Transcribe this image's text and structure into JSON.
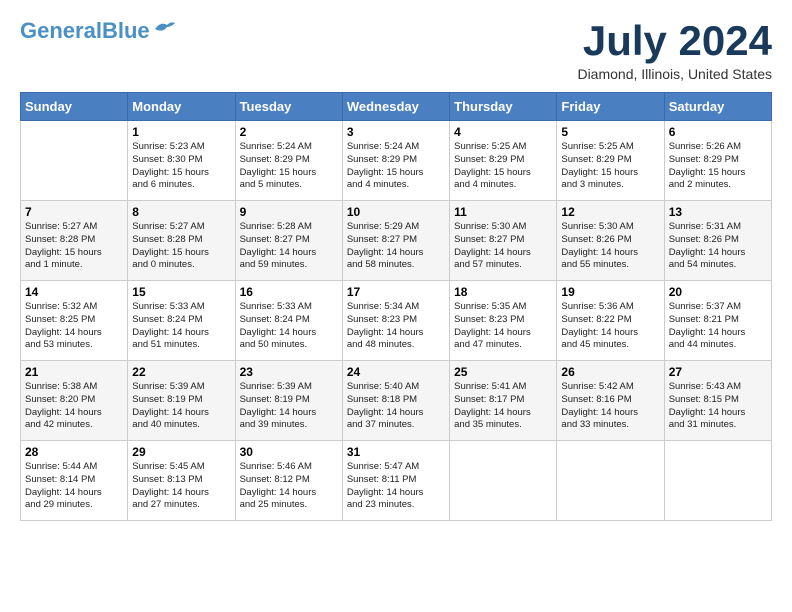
{
  "header": {
    "logo_line1": "General",
    "logo_line2": "Blue",
    "month_year": "July 2024",
    "location": "Diamond, Illinois, United States"
  },
  "weekdays": [
    "Sunday",
    "Monday",
    "Tuesday",
    "Wednesday",
    "Thursday",
    "Friday",
    "Saturday"
  ],
  "weeks": [
    [
      {
        "day": "",
        "info": ""
      },
      {
        "day": "1",
        "info": "Sunrise: 5:23 AM\nSunset: 8:30 PM\nDaylight: 15 hours\nand 6 minutes."
      },
      {
        "day": "2",
        "info": "Sunrise: 5:24 AM\nSunset: 8:29 PM\nDaylight: 15 hours\nand 5 minutes."
      },
      {
        "day": "3",
        "info": "Sunrise: 5:24 AM\nSunset: 8:29 PM\nDaylight: 15 hours\nand 4 minutes."
      },
      {
        "day": "4",
        "info": "Sunrise: 5:25 AM\nSunset: 8:29 PM\nDaylight: 15 hours\nand 4 minutes."
      },
      {
        "day": "5",
        "info": "Sunrise: 5:25 AM\nSunset: 8:29 PM\nDaylight: 15 hours\nand 3 minutes."
      },
      {
        "day": "6",
        "info": "Sunrise: 5:26 AM\nSunset: 8:29 PM\nDaylight: 15 hours\nand 2 minutes."
      }
    ],
    [
      {
        "day": "7",
        "info": "Sunrise: 5:27 AM\nSunset: 8:28 PM\nDaylight: 15 hours\nand 1 minute."
      },
      {
        "day": "8",
        "info": "Sunrise: 5:27 AM\nSunset: 8:28 PM\nDaylight: 15 hours\nand 0 minutes."
      },
      {
        "day": "9",
        "info": "Sunrise: 5:28 AM\nSunset: 8:27 PM\nDaylight: 14 hours\nand 59 minutes."
      },
      {
        "day": "10",
        "info": "Sunrise: 5:29 AM\nSunset: 8:27 PM\nDaylight: 14 hours\nand 58 minutes."
      },
      {
        "day": "11",
        "info": "Sunrise: 5:30 AM\nSunset: 8:27 PM\nDaylight: 14 hours\nand 57 minutes."
      },
      {
        "day": "12",
        "info": "Sunrise: 5:30 AM\nSunset: 8:26 PM\nDaylight: 14 hours\nand 55 minutes."
      },
      {
        "day": "13",
        "info": "Sunrise: 5:31 AM\nSunset: 8:26 PM\nDaylight: 14 hours\nand 54 minutes."
      }
    ],
    [
      {
        "day": "14",
        "info": "Sunrise: 5:32 AM\nSunset: 8:25 PM\nDaylight: 14 hours\nand 53 minutes."
      },
      {
        "day": "15",
        "info": "Sunrise: 5:33 AM\nSunset: 8:24 PM\nDaylight: 14 hours\nand 51 minutes."
      },
      {
        "day": "16",
        "info": "Sunrise: 5:33 AM\nSunset: 8:24 PM\nDaylight: 14 hours\nand 50 minutes."
      },
      {
        "day": "17",
        "info": "Sunrise: 5:34 AM\nSunset: 8:23 PM\nDaylight: 14 hours\nand 48 minutes."
      },
      {
        "day": "18",
        "info": "Sunrise: 5:35 AM\nSunset: 8:23 PM\nDaylight: 14 hours\nand 47 minutes."
      },
      {
        "day": "19",
        "info": "Sunrise: 5:36 AM\nSunset: 8:22 PM\nDaylight: 14 hours\nand 45 minutes."
      },
      {
        "day": "20",
        "info": "Sunrise: 5:37 AM\nSunset: 8:21 PM\nDaylight: 14 hours\nand 44 minutes."
      }
    ],
    [
      {
        "day": "21",
        "info": "Sunrise: 5:38 AM\nSunset: 8:20 PM\nDaylight: 14 hours\nand 42 minutes."
      },
      {
        "day": "22",
        "info": "Sunrise: 5:39 AM\nSunset: 8:19 PM\nDaylight: 14 hours\nand 40 minutes."
      },
      {
        "day": "23",
        "info": "Sunrise: 5:39 AM\nSunset: 8:19 PM\nDaylight: 14 hours\nand 39 minutes."
      },
      {
        "day": "24",
        "info": "Sunrise: 5:40 AM\nSunset: 8:18 PM\nDaylight: 14 hours\nand 37 minutes."
      },
      {
        "day": "25",
        "info": "Sunrise: 5:41 AM\nSunset: 8:17 PM\nDaylight: 14 hours\nand 35 minutes."
      },
      {
        "day": "26",
        "info": "Sunrise: 5:42 AM\nSunset: 8:16 PM\nDaylight: 14 hours\nand 33 minutes."
      },
      {
        "day": "27",
        "info": "Sunrise: 5:43 AM\nSunset: 8:15 PM\nDaylight: 14 hours\nand 31 minutes."
      }
    ],
    [
      {
        "day": "28",
        "info": "Sunrise: 5:44 AM\nSunset: 8:14 PM\nDaylight: 14 hours\nand 29 minutes."
      },
      {
        "day": "29",
        "info": "Sunrise: 5:45 AM\nSunset: 8:13 PM\nDaylight: 14 hours\nand 27 minutes."
      },
      {
        "day": "30",
        "info": "Sunrise: 5:46 AM\nSunset: 8:12 PM\nDaylight: 14 hours\nand 25 minutes."
      },
      {
        "day": "31",
        "info": "Sunrise: 5:47 AM\nSunset: 8:11 PM\nDaylight: 14 hours\nand 23 minutes."
      },
      {
        "day": "",
        "info": ""
      },
      {
        "day": "",
        "info": ""
      },
      {
        "day": "",
        "info": ""
      }
    ]
  ]
}
